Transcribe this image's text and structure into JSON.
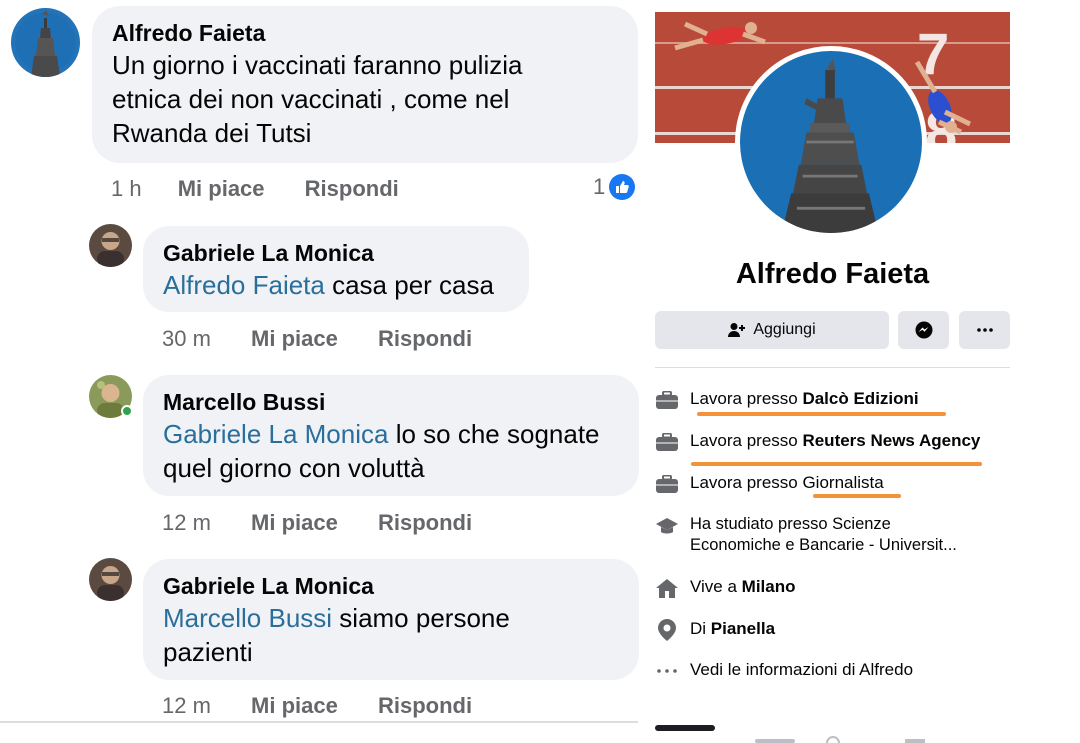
{
  "comments": [
    {
      "author": "Alfredo Faieta",
      "mention": "",
      "lines": [
        "Un giorno i vaccinati faranno pulizia",
        "etnica dei non vaccinati , come nel",
        "Rwanda dei Tutsi"
      ],
      "time": "1 h",
      "like_label": "Mi piace",
      "reply_label": "Rispondi",
      "reaction_count": "1"
    },
    {
      "author": "Gabriele La Monica",
      "mention": "Alfredo Faieta",
      "lines": [
        " casa per casa"
      ],
      "time": "30 m",
      "like_label": "Mi piace",
      "reply_label": "Rispondi"
    },
    {
      "author": "Marcello Bussi",
      "mention": "Gabriele La Monica",
      "lines": [
        " lo so che sognate",
        "quel giorno con voluttà"
      ],
      "time": "12 m",
      "like_label": "Mi piace",
      "reply_label": "Rispondi"
    },
    {
      "author": "Gabriele La Monica",
      "mention": "Marcello Bussi",
      "lines": [
        " siamo persone",
        "pazienti"
      ],
      "time": "12 m",
      "like_label": "Mi piace",
      "reply_label": "Rispondi"
    }
  ],
  "profile": {
    "name": "Alfredo Faieta",
    "add_friend_label": "Aggiungi",
    "cover_numbers": [
      "7",
      "8"
    ],
    "info": [
      {
        "icon": "briefcase-icon",
        "prefix": "Lavora presso ",
        "bold": "Dalcò Edizioni",
        "suffix": ""
      },
      {
        "icon": "briefcase-icon",
        "prefix": "Lavora presso ",
        "bold": "Reuters News Agency",
        "suffix": ""
      },
      {
        "icon": "briefcase-icon",
        "prefix": "Lavora presso ",
        "bold": "",
        "suffix": "Giornalista"
      },
      {
        "icon": "graduation-cap-icon",
        "prefix": "Ha studiato presso Scienze",
        "bold": "",
        "suffix": "Economiche e Bancarie - Universit..."
      },
      {
        "icon": "home-icon",
        "prefix": "Vive a ",
        "bold": "Milano",
        "suffix": ""
      },
      {
        "icon": "location-pin-icon",
        "prefix": "Di ",
        "bold": "Pianella",
        "suffix": ""
      },
      {
        "icon": "more-dots-icon",
        "prefix": "Vedi le informazioni di Alfredo",
        "bold": "",
        "suffix": ""
      }
    ]
  },
  "colors": {
    "mention": "#2a6f9b",
    "bubble": "#f0f2f5",
    "button": "#e4e6eb",
    "highlight": "#f4923a",
    "like": "#1877f2"
  }
}
